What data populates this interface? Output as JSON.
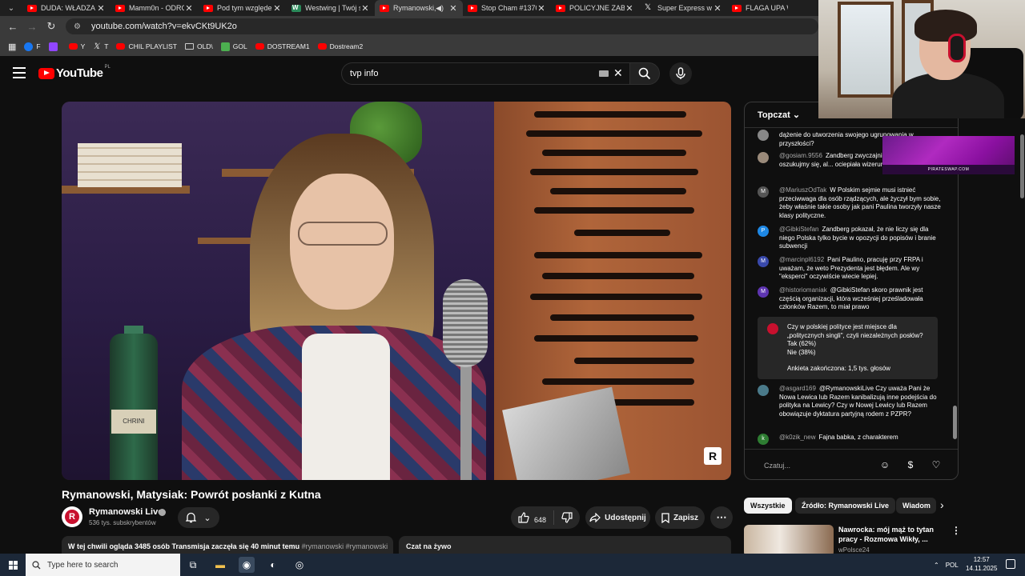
{
  "browser": {
    "tabs": [
      {
        "title": "DUDA: WŁADZA C",
        "icon": "youtube-icon",
        "active": false
      },
      {
        "title": "Mamm0n - ODRC",
        "icon": "youtube-icon",
        "active": false
      },
      {
        "title": "Pod tym względe",
        "icon": "youtube-icon",
        "active": false
      },
      {
        "title": "Westwing | Twój s",
        "icon": "westwing-icon",
        "active": false
      },
      {
        "title": "Rymanowski,",
        "icon": "youtube-icon",
        "active": true
      },
      {
        "title": "Stop Cham #1370",
        "icon": "youtube-icon",
        "active": false
      },
      {
        "title": "POLICYJNE ZABEZ",
        "icon": "youtube-icon",
        "active": false
      },
      {
        "title": "Super Express w s",
        "icon": "x-icon",
        "active": false
      },
      {
        "title": "FLAGA UPA W WA",
        "icon": "youtube-icon",
        "active": false
      }
    ],
    "url": "youtube.com/watch?v=ekvCKt9UK2o",
    "bookmarks": [
      {
        "label": "F",
        "icon": "facebook-icon"
      },
      {
        "label": "",
        "icon": "twitch-icon"
      },
      {
        "label": "Y",
        "icon": "youtube-icon"
      },
      {
        "label": "T",
        "icon": "x-icon"
      },
      {
        "label": "CHIL PLAYLIST",
        "icon": "youtube-icon"
      },
      {
        "label": "OLD\\",
        "icon": "folder-icon"
      },
      {
        "label": "GOL",
        "icon": "gol-icon"
      },
      {
        "label": "DOSTREAM1",
        "icon": "youtube-icon"
      },
      {
        "label": "Dostream2",
        "icon": "youtube-icon"
      }
    ]
  },
  "youtube": {
    "logo_text": "YouTube",
    "logo_country": "PL",
    "search_value": "tvp info"
  },
  "video": {
    "title": "Rymanowski, Matysiak: Powrót posłanki z Kutna",
    "bottle_label": "CHRINI",
    "watermark": "R",
    "channel": {
      "name": "Rymanowski Live",
      "avatar_letter": "R",
      "subscribers": "536 tys. subskrybentów"
    },
    "likes": "648",
    "share_label": "Udostępnij",
    "save_label": "Zapisz",
    "description_line": "W tej chwili ogląda 3485 osób  Transmisja zaczęła się 40 minut temu ",
    "description_tags": "#rymanowski #rymanowski",
    "livechat_label": "Czat na żywo"
  },
  "chat": {
    "mode_label": "Topczat",
    "messages": [
      {
        "author": "",
        "text": "dążenie do utworzenia swojego ugrupowania w przyszłości?",
        "avatar": "",
        "color": "#888888"
      },
      {
        "author": "@gosiam.9556",
        "text": "Zandberg zwyczajnie... w kolano, bo nie oszukujmy się, al... ociepiała wizerunek 😉",
        "avatar": "",
        "color": "#9a8a7a"
      },
      {
        "author": "@MariuszOdTak",
        "text": "W Polskim sejmie musi istnieć przeciwwaga dla osób rządzących, ale życzył bym sobie, żeby właśnie takie osoby jak pani Paulina tworzyły nasze klasy polityczne.",
        "avatar": "M",
        "color": "#555555"
      },
      {
        "author": "@GibkiStefan",
        "text": "Zandberg pokazał, że nie liczy się dla niego Polska tylko bycie w opozycji do popisów i branie subwencji",
        "avatar": "P",
        "color": "#1e88e5"
      },
      {
        "author": "@marcinpl6192",
        "text": "Pani Paulino, pracuję przy FRPA i uważam, że weto Prezydenta jest błędem. Ale wy \"eksperci\" oczywiście wiecie lepiej.",
        "avatar": "M",
        "color": "#3949ab"
      },
      {
        "author": "@historiomaniak",
        "text": "@GibkiStefan skoro prawnik jest częścią organizacji, która wcześniej prześladowała członków Razem, to miał prawo",
        "avatar": "M",
        "color": "#5e35b1"
      },
      {
        "author": "@asgard169",
        "text": "@RymanowskiLive Czy uważa Pani że Nowa Lewica lub Razem kanibalizują inne podejścia do polityka na Lewicy? Czy w Nowej Lewicy lub Razem obowiązuje dyktatura partyjną rodem z PZPR?",
        "avatar": "",
        "color": "#4a7a8a"
      },
      {
        "author": "@k0zik_new",
        "text": "Fajna babka, z charakterem",
        "avatar": "k",
        "color": "#2e7d32"
      }
    ],
    "poll": {
      "question": "Czy w polskiej polityce jest miejsce dla „politycznych singli\", czyli niezależnych posłów?",
      "options": [
        {
          "label": "Tak (62%)",
          "percent": 62
        },
        {
          "label": "Nie (38%)",
          "percent": 38
        }
      ],
      "footer": "Ankieta zakończona: 1,5 tys. głosów"
    },
    "input_placeholder": "Czatuj..."
  },
  "related": {
    "chips": [
      {
        "label": "Wszystkie",
        "active": true
      },
      {
        "label": "Źródło: Rymanowski Live",
        "active": false
      },
      {
        "label": "Wiadom",
        "active": false
      }
    ],
    "video": {
      "title": "Nawrocka: mój mąż to tytan pracy - Rozmowa Wikły, ...",
      "channel": "wPolsce24"
    }
  },
  "overlay": {
    "banner_text": "PIRATESWAP.COM"
  },
  "taskbar": {
    "search_placeholder": "Type here to search",
    "language": "POL",
    "time": "12:57",
    "date": "14.11.2025"
  },
  "colors": {
    "accent_red": "#ff0000",
    "background": "#0f0f0f",
    "surface": "#272727"
  }
}
